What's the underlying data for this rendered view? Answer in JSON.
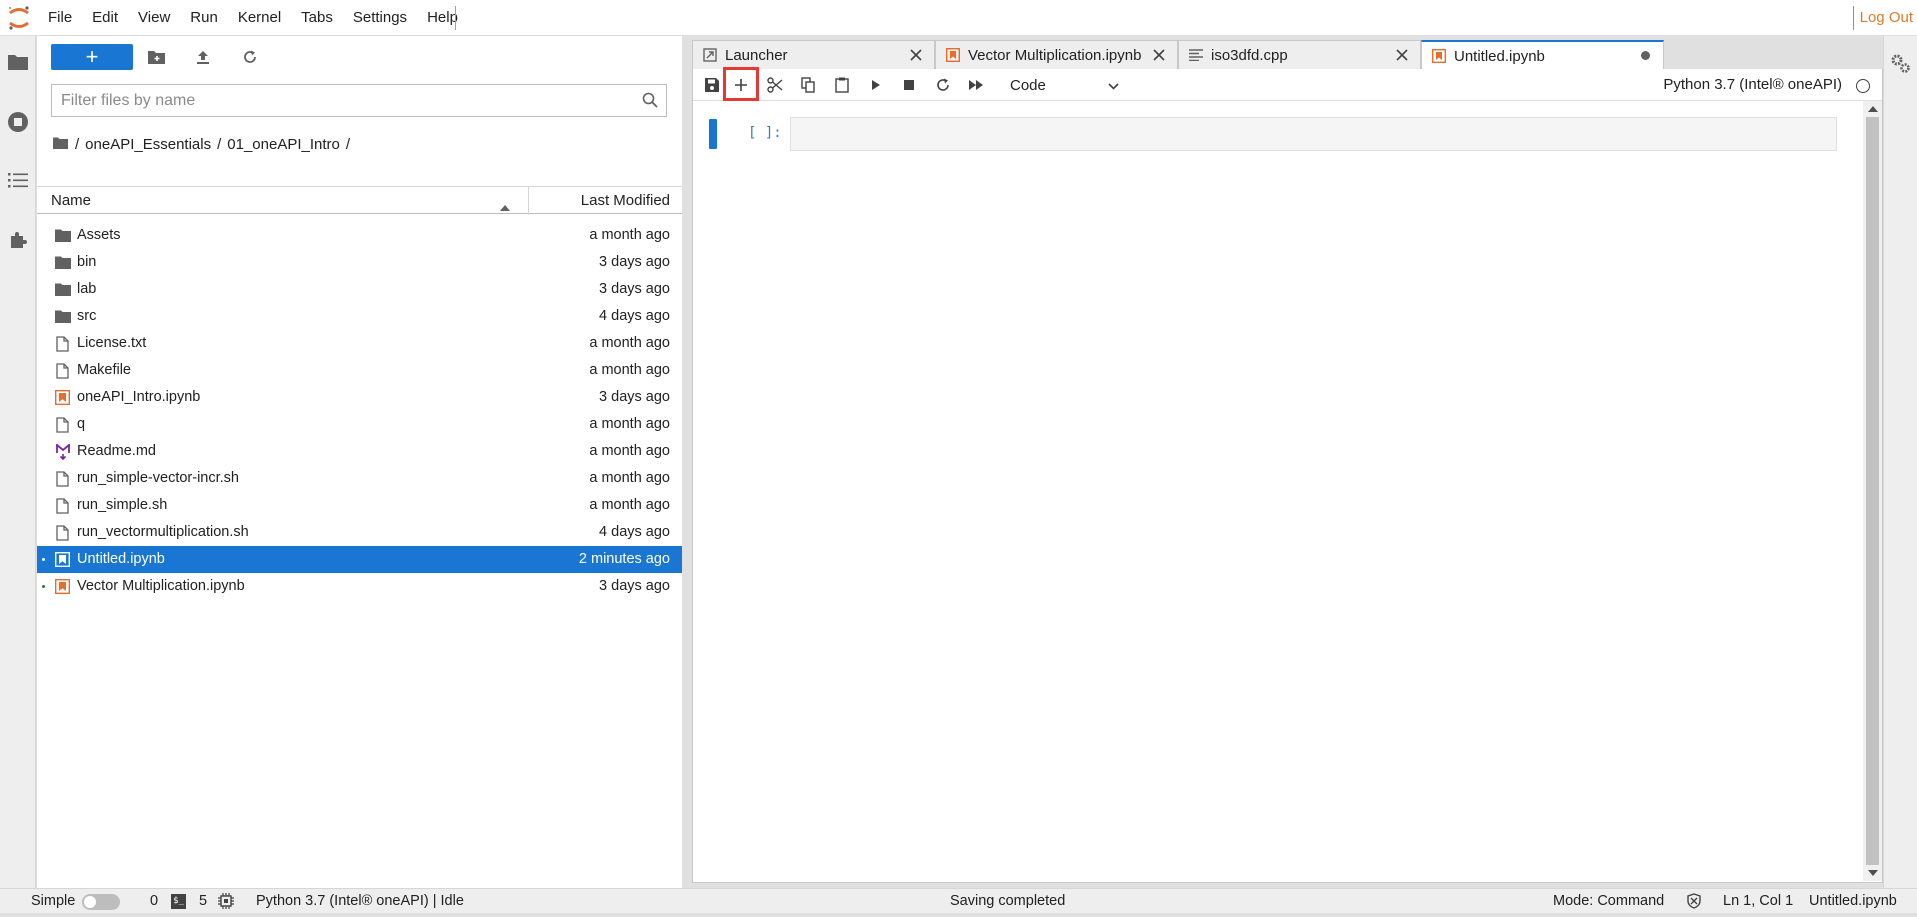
{
  "menubar": {
    "items": [
      "File",
      "Edit",
      "View",
      "Run",
      "Kernel",
      "Tabs",
      "Settings",
      "Help"
    ],
    "logout_label": "Log Out",
    "accent_color": "#e07a28"
  },
  "left_rail": {
    "icons": [
      "folder-icon",
      "running-icon",
      "toc-icon",
      "extension-icon"
    ]
  },
  "file_browser": {
    "new_label": "+",
    "filter_placeholder": "Filter files by name",
    "filter_value": "",
    "breadcrumb": [
      "/",
      "oneAPI_Essentials",
      "/",
      "01_oneAPI_Intro",
      "/"
    ],
    "columns": {
      "name": "Name",
      "modified": "Last Modified"
    },
    "files": [
      {
        "name": "Assets",
        "modified": "a month ago",
        "icon": "folder-icon",
        "running": false,
        "selected": false
      },
      {
        "name": "bin",
        "modified": "3 days ago",
        "icon": "folder-icon",
        "running": false,
        "selected": false
      },
      {
        "name": "lab",
        "modified": "3 days ago",
        "icon": "folder-icon",
        "running": false,
        "selected": false
      },
      {
        "name": "src",
        "modified": "4 days ago",
        "icon": "folder-icon",
        "running": false,
        "selected": false
      },
      {
        "name": "License.txt",
        "modified": "a month ago",
        "icon": "file-icon",
        "running": false,
        "selected": false
      },
      {
        "name": "Makefile",
        "modified": "a month ago",
        "icon": "file-icon",
        "running": false,
        "selected": false
      },
      {
        "name": "oneAPI_Intro.ipynb",
        "modified": "3 days ago",
        "icon": "notebook-icon",
        "running": false,
        "selected": false
      },
      {
        "name": "q",
        "modified": "a month ago",
        "icon": "file-icon",
        "running": false,
        "selected": false
      },
      {
        "name": "Readme.md",
        "modified": "a month ago",
        "icon": "markdown-icon",
        "running": false,
        "selected": false
      },
      {
        "name": "run_simple-vector-incr.sh",
        "modified": "a month ago",
        "icon": "file-icon",
        "running": false,
        "selected": false
      },
      {
        "name": "run_simple.sh",
        "modified": "a month ago",
        "icon": "file-icon",
        "running": false,
        "selected": false
      },
      {
        "name": "run_vectormultiplication.sh",
        "modified": "4 days ago",
        "icon": "file-icon",
        "running": false,
        "selected": false
      },
      {
        "name": "Untitled.ipynb",
        "modified": "2 minutes ago",
        "icon": "notebook-icon",
        "running": true,
        "selected": true
      },
      {
        "name": "Vector Multiplication.ipynb",
        "modified": "3 days ago",
        "icon": "notebook-icon",
        "running": true,
        "selected": false
      }
    ],
    "selection_color": "#1976d2"
  },
  "tabs": [
    {
      "label": "Launcher",
      "icon": "launcher-icon",
      "active": false,
      "dirty": false
    },
    {
      "label": "Vector Multiplication.ipynb",
      "icon": "notebook-icon",
      "active": false,
      "dirty": false
    },
    {
      "label": "iso3dfd.cpp",
      "icon": "text-file-icon",
      "active": false,
      "dirty": false
    },
    {
      "label": "Untitled.ipynb",
      "icon": "notebook-icon",
      "active": true,
      "dirty": true
    }
  ],
  "notebook": {
    "toolbar_icons": [
      "save-icon",
      "add-cell-icon",
      "cut-icon",
      "copy-icon",
      "paste-icon",
      "run-icon",
      "stop-icon",
      "restart-icon",
      "fast-forward-icon"
    ],
    "cell_type": "Code",
    "kernel_name": "Python 3.7 (Intel® oneAPI)",
    "cell_prompt": "[ ]:",
    "cell_source": ""
  },
  "statusbar": {
    "simple_label": "Simple",
    "terminals_count": "0",
    "kernels_count": "5",
    "kernel_status": "Python 3.7 (Intel® oneAPI) | Idle",
    "message": "Saving completed",
    "mode": "Mode: Command",
    "position": "Ln 1, Col 1",
    "filename": "Untitled.ipynb"
  }
}
